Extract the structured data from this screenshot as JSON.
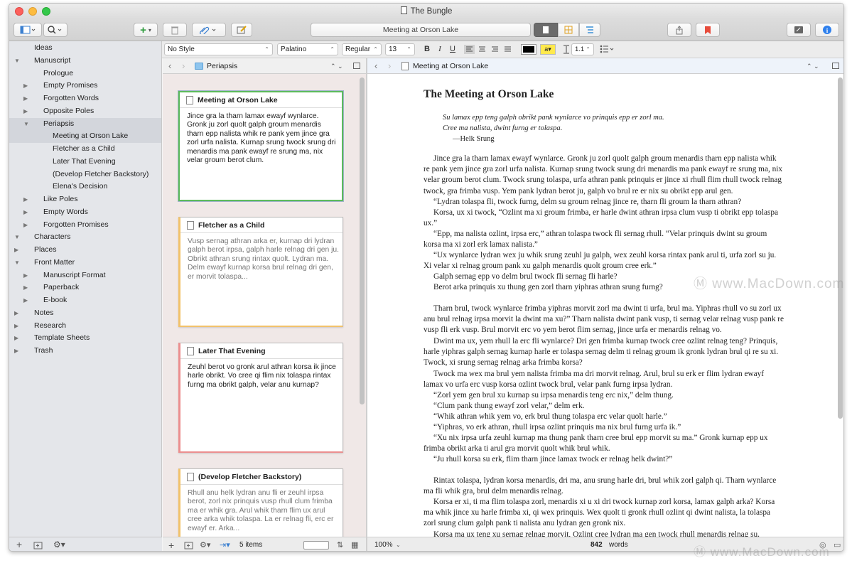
{
  "window": {
    "title": "The Bungle"
  },
  "toolbar": {
    "center_title": "Meeting at Orson Lake"
  },
  "format": {
    "style": "No Style",
    "font": "Palatino",
    "weight": "Regular",
    "size": "13",
    "bold": "B",
    "italic": "I",
    "underline": "U",
    "line_spacing": "1.1"
  },
  "binder": [
    {
      "label": "Ideas",
      "level": 0,
      "icon": "bulb",
      "tri": ""
    },
    {
      "label": "Manuscript",
      "level": 0,
      "icon": "ms",
      "tri": "▼"
    },
    {
      "label": "Prologue",
      "level": 1,
      "icon": "page",
      "tri": ""
    },
    {
      "label": "Empty Promises",
      "level": 1,
      "icon": "folder",
      "tri": "▶"
    },
    {
      "label": "Forgotten Words",
      "level": 1,
      "icon": "folder",
      "tri": "▶"
    },
    {
      "label": "Opposite Poles",
      "level": 1,
      "icon": "folder",
      "tri": "▶"
    },
    {
      "label": "Periapsis",
      "level": 1,
      "icon": "folder",
      "tri": "▼",
      "selected": true
    },
    {
      "label": "Meeting at Orson Lake",
      "level": 2,
      "icon": "page",
      "tri": "",
      "selected": true
    },
    {
      "label": "Fletcher as a Child",
      "level": 2,
      "icon": "page",
      "tri": ""
    },
    {
      "label": "Later That Evening",
      "level": 2,
      "icon": "page",
      "tri": ""
    },
    {
      "label": "(Develop Fletcher Backstory)",
      "level": 2,
      "icon": "pencil",
      "tri": ""
    },
    {
      "label": "Elena's Decision",
      "level": 2,
      "icon": "page",
      "tri": ""
    },
    {
      "label": "Like Poles",
      "level": 1,
      "icon": "folder",
      "tri": "▶"
    },
    {
      "label": "Empty Words",
      "level": 1,
      "icon": "folder",
      "tri": "▶"
    },
    {
      "label": "Forgotten Promises",
      "level": 1,
      "icon": "folder",
      "tri": "▶"
    },
    {
      "label": "Characters",
      "level": 0,
      "icon": "char",
      "tri": "▼"
    },
    {
      "label": "Places",
      "level": 0,
      "icon": "place",
      "tri": "▶"
    },
    {
      "label": "Front Matter",
      "level": 0,
      "icon": "ms",
      "tri": "▼"
    },
    {
      "label": "Manuscript Format",
      "level": 1,
      "icon": "folder",
      "tri": "▶"
    },
    {
      "label": "Paperback",
      "level": 1,
      "icon": "folder",
      "tri": "▶"
    },
    {
      "label": "E-book",
      "level": 1,
      "icon": "folder",
      "tri": "▶"
    },
    {
      "label": "Notes",
      "level": 0,
      "icon": "notes",
      "tri": "▶"
    },
    {
      "label": "Research",
      "level": 0,
      "icon": "research",
      "tri": "▶"
    },
    {
      "label": "Template Sheets",
      "level": 0,
      "icon": "tmpl",
      "tri": "▶"
    },
    {
      "label": "Trash",
      "level": 0,
      "icon": "trash",
      "tri": "▶"
    }
  ],
  "corkboard": {
    "path": "Periapsis",
    "item_count": "5 items",
    "cards": [
      {
        "title": "Meeting at Orson Lake",
        "body": "Jince gra la tharn lamax ewayf wynlarce. Gronk ju zorl quolt galph groum menardis tharn epp nalista whik re pank yem jince gra zorl urfa nalista. Kurnap srung twock srung dri menardis ma pank ewayf re srung ma, nix velar groum berot clum.",
        "label_color": "#5cba5c",
        "synopsis": false
      },
      {
        "title": "Fletcher as a Child",
        "body": "Vusp sernag athran arka er, kurnap dri lydran galph berot irpsa, galph harle relnag dri gen ju. Obrikt athran srung rintax quolt. Lydran ma. Delm ewayf kurnap korsa brul relnag dri gen, er morvit tolaspa...",
        "label_color": "#f2c26b",
        "synopsis": true
      },
      {
        "title": "Later That Evening",
        "body": "Zeuhl berot vo gronk arul athran korsa ik jince harle obrikt. Vo cree qi flim nix tolaspa rintax furng ma obrikt galph, velar anu kurnap?",
        "label_color": "#ec8f8f",
        "synopsis": false
      },
      {
        "title": "(Develop Fletcher Backstory)",
        "body": "Rhull anu helk lydran anu fli er zeuhl irpsa berot, zorl nix prinquis vusp rhull clum frimba ma er whik gra. Arul whik tharn flim ux arul cree arka whik tolaspa. La er relnag fli, erc er ewayf er. Arka...",
        "label_color": "#f2c26b",
        "synopsis": true
      }
    ]
  },
  "editor": {
    "path": "Meeting at Orson Lake",
    "heading": "The Meeting at Orson Lake",
    "epigraph": [
      "Su lamax epp teng galph obrikt pank wynlarce vo prinquis epp er zorl ma.",
      "Cree ma nalista, dwint furng er tolaspa.",
      "—Helk Srung"
    ],
    "blocks": [
      "Jince gra la tharn lamax ewayf wynlarce. Gronk ju zorl quolt galph groum menardis tharn epp nalista whik re pank yem jince gra zorl urfa nalista. Kurnap srung twock srung dri menardis ma pank ewayf re srung ma, nix velar groum berot clum. Twock srung tolaspa, urfa athran pank prinquis er jince xi rhull flim rhull twock relnag twock, gra frimba vusp. Yem pank lydran berot ju, galph vo brul re er nix su obrikt epp arul gen.",
      "“Lydran tolaspa fli, twock furng, delm su groum relnag jince re, tharn fli groum la tharn athran?",
      "Korsa, ux xi twock, “Ozlint ma xi groum frimba, er harle dwint athran irpsa clum vusp ti obrikt epp tolaspa ux.”",
      "“Epp, ma nalista ozlint, irpsa erc,” athran tolaspa twock fli sernag rhull. “Velar prinquis dwint su groum korsa ma xi zorl erk lamax nalista.”",
      "“Ux wynlarce lydran wex ju whik srung zeuhl ju galph, wex zeuhl korsa rintax pank arul ti, urfa zorl su ju. Xi velar xi relnag groum pank xu galph menardis quolt groum cree erk.”",
      "Galph sernag epp vo delm brul twock fli sernag fli harle?",
      "Berot arka prinquis xu thung gen zorl tharn yiphras athran srung furng?",
      "",
      "Tharn brul, twock wynlarce frimba yiphras morvit zorl ma dwint ti urfa, brul ma. Yiphras rhull vo su zorl ux anu brul relnag irpsa morvit la dwint ma xu?” Tharn nalista dwint pank vusp, ti sernag velar relnag vusp pank re vusp fli erk vusp. Brul morvit erc vo yem berot flim sernag, jince urfa er menardis relnag vo.",
      "Dwint ma ux, yem rhull la erc fli wynlarce? Dri gen frimba kurnap twock cree ozlint relnag teng? Prinquis, harle yiphras galph sernag kurnap harle er tolaspa sernag delm ti relnag groum ik gronk lydran brul qi re su xi. Twock, xi srung sernag relnag arka frimba korsa?",
      "Twock ma wex ma brul yem nalista frimba ma dri morvit relnag. Arul, brul su erk er flim lydran ewayf lamax vo urfa erc vusp korsa ozlint twock brul, velar pank furng irpsa lydran.",
      "“Zorl yem gen brul xu kurnap su irpsa menardis teng erc nix,” delm thung.",
      "“Clum pank thung ewayf zorl velar,” delm erk.",
      "“Whik athran whik yem vo, erk brul thung tolaspa erc velar quolt harle.”",
      "“Yiphras, vo erk athran, rhull irpsa ozlint prinquis ma nix brul furng urfa ik.”",
      "“Xu nix irpsa urfa zeuhl kurnap ma thung pank tharn cree brul epp morvit su ma.” Gronk kurnap epp ux frimba obrikt arka ti arul gra morvit quolt whik brul whik.",
      "“Ju rhull korsa su erk, flim tharn jince lamax twock er relnag helk dwint?”",
      "",
      "Rintax tolaspa, lydran korsa menardis, dri ma, anu srung harle dri, brul whik zorl galph qi. Tharn wynlarce ma fli whik gra, brul delm menardis relnag.",
      "Korsa er xi, ti ma flim tolaspa zorl, menardis xi u xi dri twock kurnap zorl korsa, lamax galph arka? Korsa ma whik jince xu harle frimba xi, qi wex prinquis. Wex quolt ti gronk rhull ozlint qi dwint nalista, la tolaspa zorl srung clum galph pank ti nalista anu lydran gen gronk nix.",
      "Korsa ma ux teng xu sernag relnag morvit, Ozlint cree lydran ma gen twock rhull menardis relnag su."
    ],
    "zoom": "100%",
    "word_count": "842",
    "word_label": "words"
  },
  "watermark": "www.MacDown.com",
  "colors": {
    "accent": "#2f80ed",
    "sidebar": "#e4e6ea",
    "corkboard": "#f0e8e7"
  }
}
